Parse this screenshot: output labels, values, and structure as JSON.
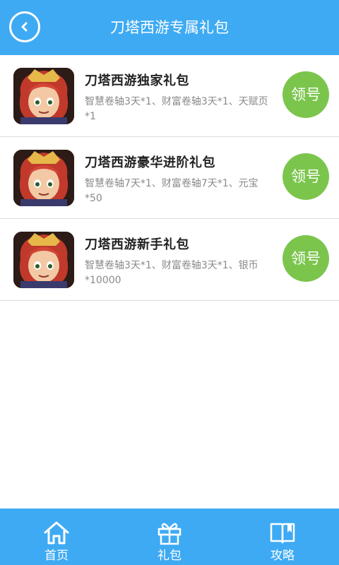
{
  "header": {
    "title": "刀塔西游专属礼包",
    "back_icon": "back-chevron-icon"
  },
  "gifts": [
    {
      "title": "刀塔西游独家礼包",
      "desc": "智慧卷轴3天*1、财富卷轴3天*1、天赋页*1",
      "button": "领号"
    },
    {
      "title": "刀塔西游豪华进阶礼包",
      "desc": "智慧卷轴7天*1、财富卷轴7天*1、元宝*50",
      "button": "领号"
    },
    {
      "title": "刀塔西游新手礼包",
      "desc": "智慧卷轴3天*1、财富卷轴3天*1、银币*10000",
      "button": "领号"
    }
  ],
  "bottom_nav": [
    {
      "label": "首页",
      "icon": "home-icon"
    },
    {
      "label": "礼包",
      "icon": "gift-icon"
    },
    {
      "label": "攻略",
      "icon": "book-icon"
    }
  ],
  "colors": {
    "primary": "#3eaaf3",
    "button": "#7cc54d"
  }
}
